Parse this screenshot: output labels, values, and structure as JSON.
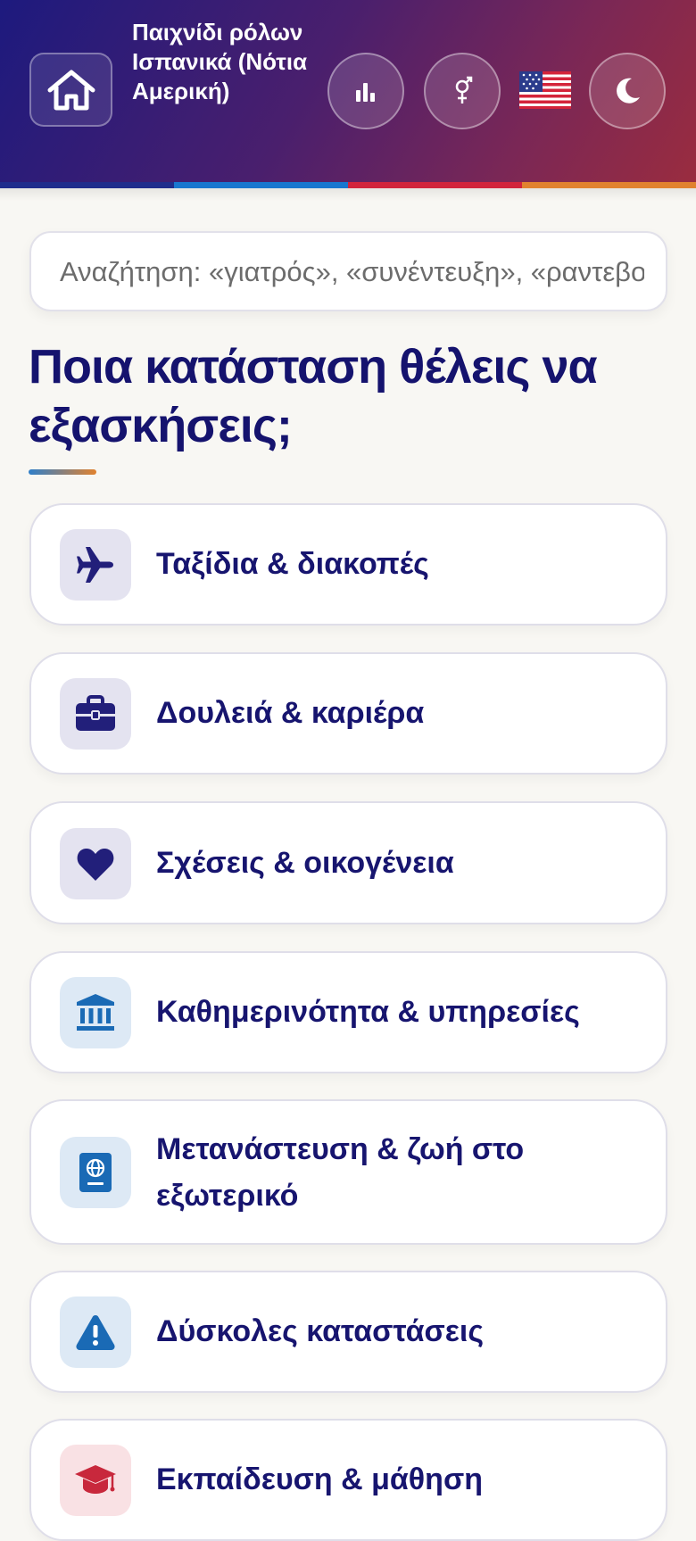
{
  "header": {
    "title": "Παιχνίδι ρόλων Ισπανικά (Νότια Αμερική)",
    "home_icon": "home-icon",
    "stats_icon": "bar-chart-icon",
    "gender_icon": "gender-icon",
    "language_flag": "us-flag-icon",
    "theme_icon": "moon-icon",
    "stripe_colors": [
      "#1f2d8c",
      "#1877cf",
      "#d2243c",
      "#e1822f"
    ]
  },
  "search": {
    "placeholder": "Αναζήτηση: «γιατρός», «συνέντευξη», «ραντεβού»"
  },
  "main": {
    "heading": "Ποια κατάσταση θέλεις να εξασκήσεις;"
  },
  "categories": [
    {
      "label": "Ταξίδια & διακοπές",
      "icon": "airplane-icon",
      "icon_bg": "#e4e3f0",
      "icon_color": "#221f7a"
    },
    {
      "label": "Δουλειά & καριέρα",
      "icon": "briefcase-icon",
      "icon_bg": "#e4e3f0",
      "icon_color": "#221f7a"
    },
    {
      "label": "Σχέσεις & οικογένεια",
      "icon": "heart-icon",
      "icon_bg": "#e4e3f0",
      "icon_color": "#221f7a"
    },
    {
      "label": "Καθημερινότητα & υπηρεσίες",
      "icon": "bank-icon",
      "icon_bg": "#dde9f5",
      "icon_color": "#1a6ab5"
    },
    {
      "label": "Μετανάστευση & ζωή στο εξωτερικό",
      "icon": "passport-icon",
      "icon_bg": "#dde9f5",
      "icon_color": "#1a6ab5"
    },
    {
      "label": "Δύσκολες καταστάσεις",
      "icon": "warning-icon",
      "icon_bg": "#dde9f5",
      "icon_color": "#1a6ab5"
    },
    {
      "label": "Εκπαίδευση & μάθηση",
      "icon": "graduation-cap-icon",
      "icon_bg": "#f9e1e4",
      "icon_color": "#c8283c"
    }
  ]
}
